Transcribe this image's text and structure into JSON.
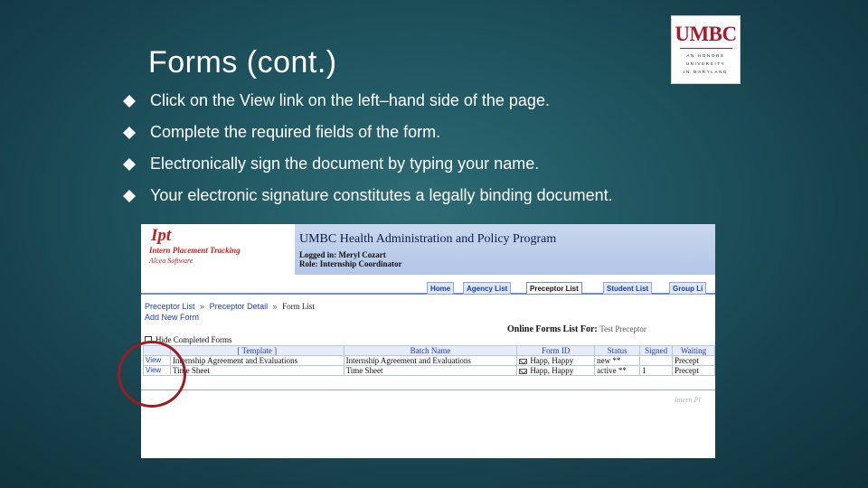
{
  "slide": {
    "title": "Forms (cont.)",
    "bullets": [
      "Click on the View link on the left–hand side of the page.",
      "Complete the required fields of the form.",
      "Electronically sign the document by typing your name.",
      "Your electronic signature constitutes a legally binding document."
    ]
  },
  "logo": {
    "word": "UMBC",
    "lines": [
      "AN HONORS",
      "UNIVERSITY",
      "IN MARYLAND"
    ]
  },
  "app": {
    "logo_big": "Ipt",
    "logo_sub": "Intern Placement Tracking",
    "logo_vendor": "Alcea Software",
    "name": "UMBC Health Administration and Policy Program",
    "logged_in": "Logged in: Meryl Cozart",
    "role": "Role: Internship Coordinator",
    "tabs": [
      "Home",
      "Agency List",
      "Preceptor List",
      "Student List",
      "Group Li"
    ],
    "breadcrumb": [
      "Preceptor List",
      "Preceptor Detail",
      "Form List"
    ],
    "breadcrumb_sep": "»",
    "add_form": "Add New Form",
    "forms_title": "Online Forms List For:",
    "forms_for": "Test Preceptor",
    "hide_completed": "Hide Completed Forms",
    "columns": [
      "",
      "[ Template ]",
      "Batch Name",
      "Form ID",
      "Status",
      "Signed",
      "Waiting"
    ],
    "rows": [
      [
        "View",
        "Internship Agreement and Evaluations",
        "Internship Agreement and Evaluations",
        "Happ, Happy",
        "new **",
        "",
        "Precept"
      ],
      [
        "View",
        "Time Sheet",
        "Time Sheet",
        "Happ, Happy",
        "active **",
        "1",
        "Precept"
      ]
    ],
    "footer": "Intern Pl"
  },
  "colors": {
    "background": "#1f5560",
    "umbc_red": "#a6192e",
    "link_blue": "#1b3ac8",
    "circle": "#9b1c24"
  }
}
